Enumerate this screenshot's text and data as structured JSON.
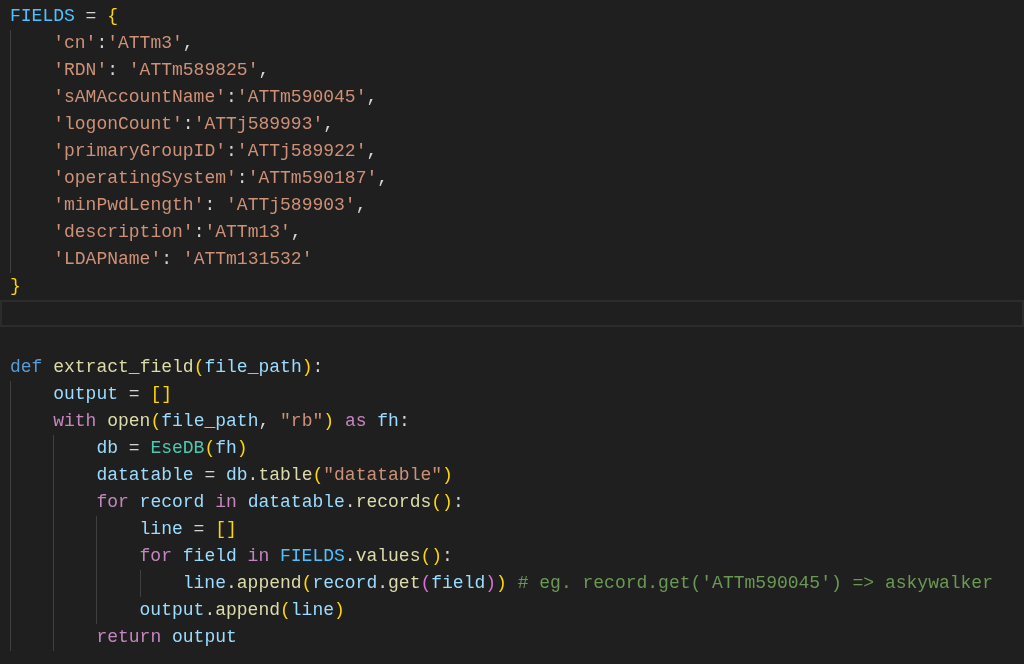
{
  "editor": {
    "lines": [
      {
        "current": false,
        "tokens": [
          {
            "kind": "const",
            "text": "FIELDS"
          },
          {
            "kind": "punct",
            "text": " = "
          },
          {
            "kind": "bracket1",
            "text": "{"
          }
        ],
        "children": [
          {
            "current": false,
            "tokens": [
              {
                "kind": "string",
                "text": "'cn'"
              },
              {
                "kind": "punct",
                "text": ":"
              },
              {
                "kind": "string",
                "text": "'ATTm3'"
              },
              {
                "kind": "punct",
                "text": ","
              }
            ]
          },
          {
            "current": false,
            "tokens": [
              {
                "kind": "string",
                "text": "'RDN'"
              },
              {
                "kind": "punct",
                "text": ": "
              },
              {
                "kind": "string",
                "text": "'ATTm589825'"
              },
              {
                "kind": "punct",
                "text": ","
              }
            ]
          },
          {
            "current": false,
            "tokens": [
              {
                "kind": "string",
                "text": "'sAMAccountName'"
              },
              {
                "kind": "punct",
                "text": ":"
              },
              {
                "kind": "string",
                "text": "'ATTm590045'"
              },
              {
                "kind": "punct",
                "text": ","
              }
            ]
          },
          {
            "current": false,
            "tokens": [
              {
                "kind": "string",
                "text": "'logonCount'"
              },
              {
                "kind": "punct",
                "text": ":"
              },
              {
                "kind": "string",
                "text": "'ATTj589993'"
              },
              {
                "kind": "punct",
                "text": ","
              }
            ]
          },
          {
            "current": false,
            "tokens": [
              {
                "kind": "string",
                "text": "'primaryGroupID'"
              },
              {
                "kind": "punct",
                "text": ":"
              },
              {
                "kind": "string",
                "text": "'ATTj589922'"
              },
              {
                "kind": "punct",
                "text": ","
              }
            ]
          },
          {
            "current": false,
            "tokens": [
              {
                "kind": "string",
                "text": "'operatingSystem'"
              },
              {
                "kind": "punct",
                "text": ":"
              },
              {
                "kind": "string",
                "text": "'ATTm590187'"
              },
              {
                "kind": "punct",
                "text": ","
              }
            ]
          },
          {
            "current": false,
            "tokens": [
              {
                "kind": "string",
                "text": "'minPwdLength'"
              },
              {
                "kind": "punct",
                "text": ": "
              },
              {
                "kind": "string",
                "text": "'ATTj589903'"
              },
              {
                "kind": "punct",
                "text": ","
              }
            ]
          },
          {
            "current": false,
            "tokens": [
              {
                "kind": "string",
                "text": "'description'"
              },
              {
                "kind": "punct",
                "text": ":"
              },
              {
                "kind": "string",
                "text": "'ATTm13'"
              },
              {
                "kind": "punct",
                "text": ","
              }
            ]
          },
          {
            "current": false,
            "tokens": [
              {
                "kind": "string",
                "text": "'LDAPName'"
              },
              {
                "kind": "punct",
                "text": ": "
              },
              {
                "kind": "string",
                "text": "'ATTm131532'"
              }
            ]
          }
        ]
      },
      {
        "current": false,
        "tokens": [
          {
            "kind": "bracket1",
            "text": "}"
          }
        ]
      },
      {
        "current": true
      },
      {
        "current": false
      },
      {
        "current": false,
        "tokens": [
          {
            "kind": "keyword",
            "text": "def "
          },
          {
            "kind": "function",
            "text": "extract_field"
          },
          {
            "kind": "bracket1",
            "text": "("
          },
          {
            "kind": "variable",
            "text": "file_path"
          },
          {
            "kind": "bracket1",
            "text": ")"
          },
          {
            "kind": "punct",
            "text": ":"
          }
        ],
        "children": [
          {
            "current": false,
            "tokens": [
              {
                "kind": "variable",
                "text": "output"
              },
              {
                "kind": "punct",
                "text": " = "
              },
              {
                "kind": "bracket1",
                "text": "[]"
              }
            ]
          },
          {
            "current": false,
            "tokens": [
              {
                "kind": "control",
                "text": "with "
              },
              {
                "kind": "function",
                "text": "open"
              },
              {
                "kind": "bracket1",
                "text": "("
              },
              {
                "kind": "variable",
                "text": "file_path"
              },
              {
                "kind": "punct",
                "text": ", "
              },
              {
                "kind": "string",
                "text": "\"rb\""
              },
              {
                "kind": "bracket1",
                "text": ") "
              },
              {
                "kind": "control",
                "text": "as "
              },
              {
                "kind": "variable",
                "text": "fh"
              },
              {
                "kind": "punct",
                "text": ":"
              }
            ],
            "children": [
              {
                "current": false,
                "tokens": [
                  {
                    "kind": "variable",
                    "text": "db"
                  },
                  {
                    "kind": "punct",
                    "text": " = "
                  },
                  {
                    "kind": "class",
                    "text": "EseDB"
                  },
                  {
                    "kind": "bracket1",
                    "text": "("
                  },
                  {
                    "kind": "variable",
                    "text": "fh"
                  },
                  {
                    "kind": "bracket1",
                    "text": ")"
                  }
                ]
              },
              {
                "current": false,
                "tokens": [
                  {
                    "kind": "variable",
                    "text": "datatable"
                  },
                  {
                    "kind": "punct",
                    "text": " = "
                  },
                  {
                    "kind": "variable",
                    "text": "db"
                  },
                  {
                    "kind": "punct",
                    "text": "."
                  },
                  {
                    "kind": "function",
                    "text": "table"
                  },
                  {
                    "kind": "bracket1",
                    "text": "("
                  },
                  {
                    "kind": "string",
                    "text": "\"datatable\""
                  },
                  {
                    "kind": "bracket1",
                    "text": ")"
                  }
                ]
              },
              {
                "current": false,
                "tokens": [
                  {
                    "kind": "control",
                    "text": "for "
                  },
                  {
                    "kind": "variable",
                    "text": "record "
                  },
                  {
                    "kind": "control",
                    "text": "in "
                  },
                  {
                    "kind": "variable",
                    "text": "datatable"
                  },
                  {
                    "kind": "punct",
                    "text": "."
                  },
                  {
                    "kind": "function",
                    "text": "records"
                  },
                  {
                    "kind": "bracket1",
                    "text": "()"
                  },
                  {
                    "kind": "punct",
                    "text": ":"
                  }
                ],
                "children": [
                  {
                    "current": false,
                    "tokens": [
                      {
                        "kind": "variable",
                        "text": "line"
                      },
                      {
                        "kind": "punct",
                        "text": " = "
                      },
                      {
                        "kind": "bracket1",
                        "text": "[]"
                      }
                    ]
                  },
                  {
                    "current": false,
                    "tokens": [
                      {
                        "kind": "control",
                        "text": "for "
                      },
                      {
                        "kind": "variable",
                        "text": "field "
                      },
                      {
                        "kind": "control",
                        "text": "in "
                      },
                      {
                        "kind": "const",
                        "text": "FIELDS"
                      },
                      {
                        "kind": "punct",
                        "text": "."
                      },
                      {
                        "kind": "function",
                        "text": "values"
                      },
                      {
                        "kind": "bracket1",
                        "text": "()"
                      },
                      {
                        "kind": "punct",
                        "text": ":"
                      }
                    ],
                    "children": [
                      {
                        "current": false,
                        "tokens": [
                          {
                            "kind": "variable",
                            "text": "line"
                          },
                          {
                            "kind": "punct",
                            "text": "."
                          },
                          {
                            "kind": "function",
                            "text": "append"
                          },
                          {
                            "kind": "bracket1",
                            "text": "("
                          },
                          {
                            "kind": "variable",
                            "text": "record"
                          },
                          {
                            "kind": "punct",
                            "text": "."
                          },
                          {
                            "kind": "function",
                            "text": "get"
                          },
                          {
                            "kind": "bracket2",
                            "text": "("
                          },
                          {
                            "kind": "variable",
                            "text": "field"
                          },
                          {
                            "kind": "bracket2",
                            "text": ")"
                          },
                          {
                            "kind": "bracket1",
                            "text": ") "
                          },
                          {
                            "kind": "comment",
                            "text": "# eg. record.get('ATTm590045') => askywalker"
                          }
                        ]
                      }
                    ]
                  },
                  {
                    "current": false,
                    "tokens": [
                      {
                        "kind": "variable",
                        "text": "output"
                      },
                      {
                        "kind": "punct",
                        "text": "."
                      },
                      {
                        "kind": "function",
                        "text": "append"
                      },
                      {
                        "kind": "bracket1",
                        "text": "("
                      },
                      {
                        "kind": "variable",
                        "text": "line"
                      },
                      {
                        "kind": "bracket1",
                        "text": ")"
                      }
                    ]
                  }
                ]
              },
              {
                "current": false,
                "tokens": [
                  {
                    "kind": "control",
                    "text": "return "
                  },
                  {
                    "kind": "variable",
                    "text": "output"
                  }
                ]
              }
            ]
          }
        ]
      }
    ]
  }
}
